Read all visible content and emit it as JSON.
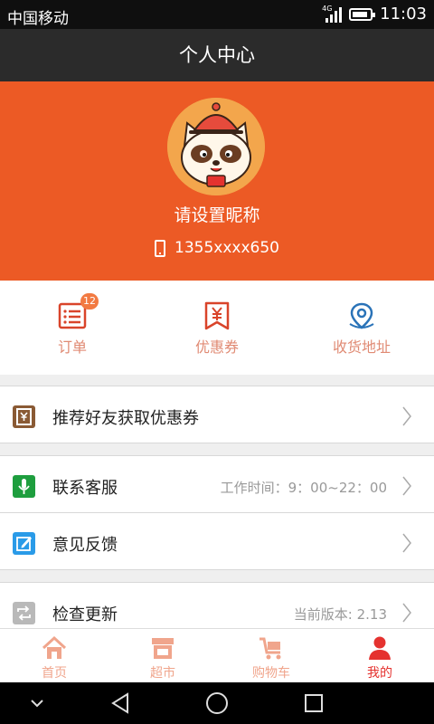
{
  "status_bar": {
    "carrier": "中国移动",
    "network": "4G",
    "time": "11:03",
    "battery_level": 0.8
  },
  "header": {
    "title": "个人中心"
  },
  "profile": {
    "nickname": "请设置昵称",
    "phone": "1355xxxx650",
    "avatar_icon": "raccoon-avatar-icon",
    "background_color": "#ec5a25"
  },
  "quick_actions": [
    {
      "label": "订单",
      "icon": "order-list-icon",
      "badge": "12"
    },
    {
      "label": "优惠券",
      "icon": "coupon-icon"
    },
    {
      "label": "收货地址",
      "icon": "location-pin-icon"
    }
  ],
  "menu": {
    "invite": {
      "label": "推荐好友获取优惠券",
      "icon": "invite-coupon-icon",
      "icon_color": "#8a5a34"
    },
    "support": {
      "label": "联系客服",
      "meta": "工作时间：9：00~22：00",
      "icon": "microphone-icon",
      "icon_color": "#1e9e3e"
    },
    "feedback": {
      "label": "意见反馈",
      "icon": "edit-icon",
      "icon_color": "#2a9be8"
    },
    "update": {
      "label": "检查更新",
      "meta": "当前版本: 2.13",
      "icon": "refresh-icon",
      "icon_color": "#b9b9b9"
    }
  },
  "tabbar": [
    {
      "label": "首页",
      "icon": "home-icon",
      "active": false
    },
    {
      "label": "超市",
      "icon": "store-icon",
      "active": false
    },
    {
      "label": "购物车",
      "icon": "cart-icon",
      "active": false
    },
    {
      "label": "我的",
      "icon": "user-icon",
      "active": true
    }
  ],
  "colors": {
    "accent": "#ec5a25",
    "tab_inactive": "#f0a58c",
    "tab_active": "#e5322f"
  }
}
